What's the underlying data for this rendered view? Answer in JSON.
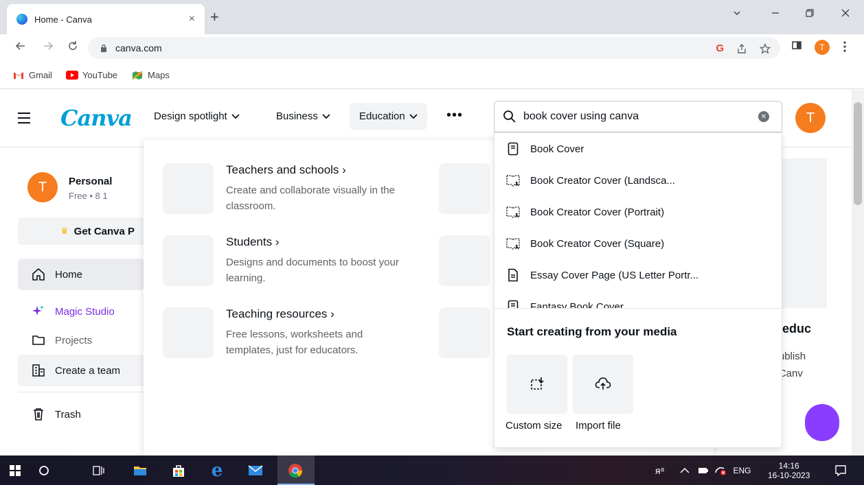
{
  "browser": {
    "tab_title": "Home - Canva",
    "tab_close": "×",
    "new_tab": "+",
    "url": "canva.com",
    "profile_initial": "T",
    "bookmarks": [
      {
        "label": "Gmail",
        "icon": "gmail-icon"
      },
      {
        "label": "YouTube",
        "icon": "youtube-icon"
      },
      {
        "label": "Maps",
        "icon": "maps-icon"
      }
    ]
  },
  "topnav": {
    "logo": "Canva",
    "links": [
      {
        "label": "Design spotlight"
      },
      {
        "label": "Business"
      },
      {
        "label": "Education"
      }
    ],
    "more": "•••",
    "avatar_initial": "T"
  },
  "search": {
    "value": "book cover using canva",
    "suggestions": [
      {
        "label": "Book Cover",
        "icon": "book-icon"
      },
      {
        "label": "Book Creator Cover (Landsca...",
        "icon": "book-creator-icon"
      },
      {
        "label": "Book Creator Cover (Portrait)",
        "icon": "book-creator-icon"
      },
      {
        "label": "Book Creator Cover (Square)",
        "icon": "book-creator-icon"
      },
      {
        "label": "Essay Cover Page (US Letter Portr...",
        "icon": "document-icon"
      },
      {
        "label": "Fantasy Book Cover",
        "icon": "book-icon"
      }
    ],
    "media_title": "Start creating from your media",
    "custom_size": "Custom size",
    "import_file": "Import file"
  },
  "sidebar": {
    "account_initial": "T",
    "account_name": "Personal",
    "account_sub": "Free • 8 1",
    "get_pro": "Get Canva P",
    "items": [
      {
        "label": "Home"
      },
      {
        "label": "Magic Studio"
      },
      {
        "label": "Projects"
      },
      {
        "label": "Create a team"
      },
      {
        "label": "Trash"
      }
    ]
  },
  "education_menu": {
    "items": [
      {
        "title": "Teachers and schools ›",
        "desc": "Create and collaborate visually in the classroom."
      },
      {
        "title": "Students ›",
        "desc": "Designs and documents to boost your learning."
      },
      {
        "title": "Teaching resources ›",
        "desc": "Free lessons, worksheets and templates, just for educators."
      }
    ]
  },
  "right_content": {
    "heading": "an educ",
    "line1": "d publish",
    "line2": "on Canv"
  },
  "taskbar": {
    "lang": "ENG",
    "time": "14:16",
    "date": "16-10-2023"
  },
  "colors": {
    "canva_brand": "#00a0d6",
    "avatar": "#f57c1f",
    "magic_purple": "#7d2ae8",
    "fab_purple": "#8b3dff"
  }
}
